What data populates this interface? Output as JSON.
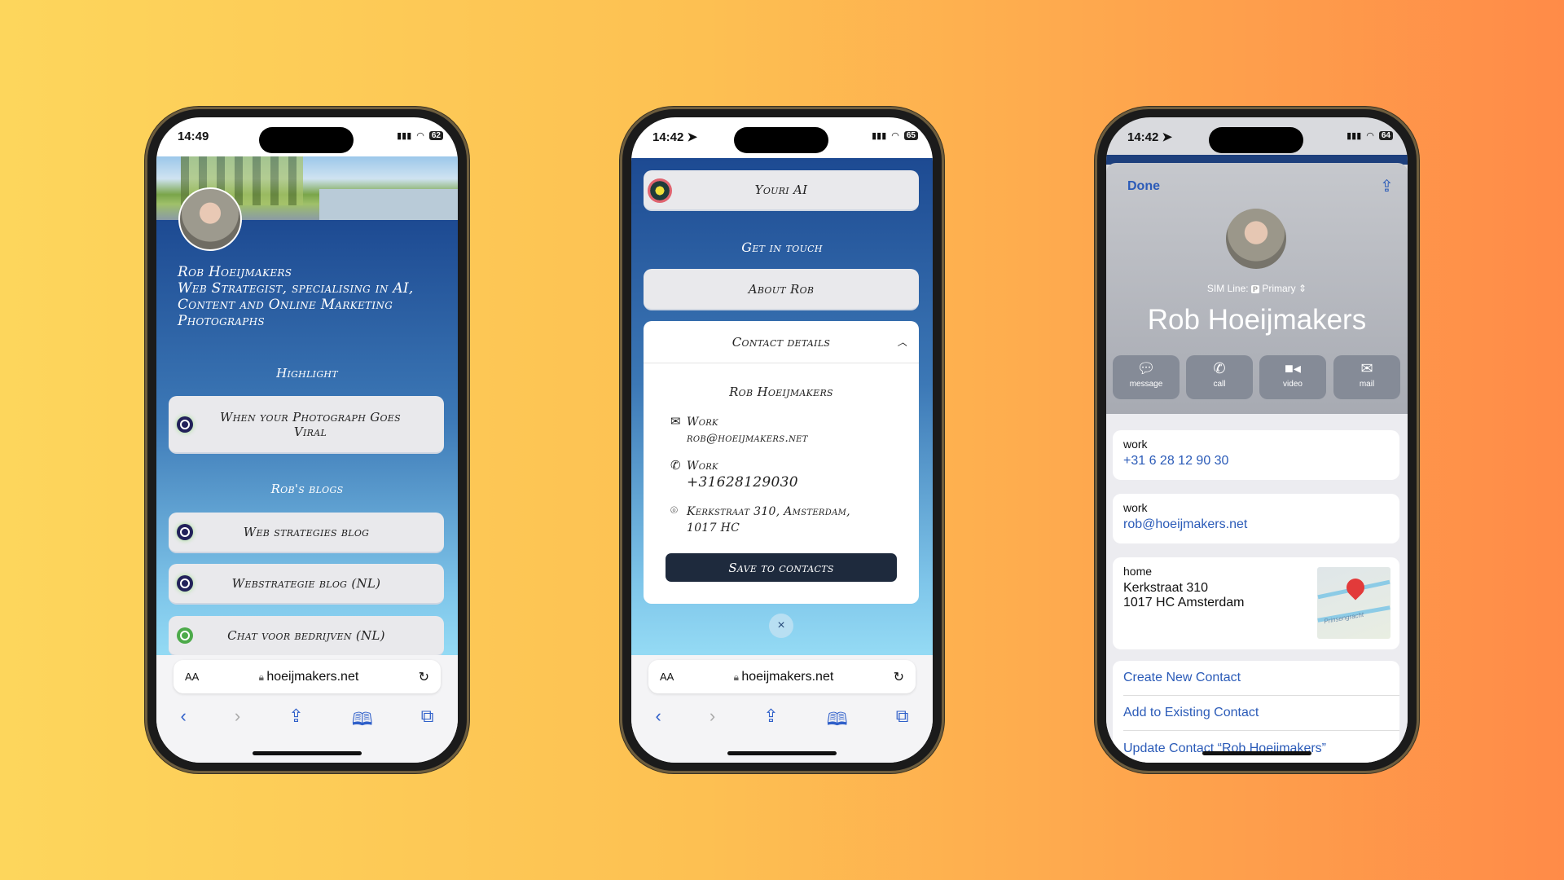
{
  "background": {
    "colors": [
      "#fdd65c",
      "#ff8b48"
    ]
  },
  "phone1": {
    "status": {
      "time": "14:49",
      "battery": "62"
    },
    "profile": {
      "name": "Rob Hoeijmakers",
      "tagline_lines": [
        "Web Strategist, specialising in AI,",
        "Content and Online Marketing",
        "Photographs"
      ]
    },
    "highlight": {
      "heading": "Highlight",
      "item": "When your Photograph Goes Viral"
    },
    "blogs": {
      "heading": "Rob's blogs",
      "items": [
        {
          "label": "Web strategies blog",
          "icon": "podcast-icon"
        },
        {
          "label": "Webstrategie blog (NL)",
          "icon": "podcast-icon"
        },
        {
          "label": "Chat voor bedrijven (NL)",
          "icon": "chat-icon"
        }
      ]
    },
    "safari": {
      "aa": "AA",
      "url": "hoeijmakers.net"
    }
  },
  "phone2": {
    "status": {
      "time": "14:42",
      "battery": "65"
    },
    "youri": "Youri AI",
    "get_in_touch": "Get in touch",
    "about": "About Rob",
    "contact": {
      "title": "Contact details",
      "name": "Rob Hoeijmakers",
      "email_label": "Work",
      "email": "rob@hoeijmakers.net",
      "phone_label": "Work",
      "phone": "+31628129030",
      "address_line1": "Kerkstraat 310, Amsterdam,",
      "address_line2": "1017 HC",
      "save": "Save to contacts",
      "close": "×"
    },
    "safari": {
      "aa": "AA",
      "url": "hoeijmakers.net"
    }
  },
  "phone3": {
    "status": {
      "time": "14:42",
      "battery": "64"
    },
    "done": "Done",
    "sim_label": "SIM Line:",
    "sim_badge": "P",
    "sim_value": "Primary",
    "name": "Rob Hoeijmakers",
    "actions": [
      "message",
      "call",
      "video",
      "mail"
    ],
    "phone": {
      "label": "work",
      "value": "+31 6 28 12 90 30"
    },
    "email": {
      "label": "work",
      "value": "rob@hoeijmakers.net"
    },
    "address": {
      "label": "home",
      "line1": "Kerkstraat 310",
      "line2": "1017 HC Amsterdam",
      "map_label": "Prinsengracht"
    },
    "rows": [
      "Create New Contact",
      "Add to Existing Contact",
      "Update Contact “Rob Hoeijmakers”"
    ],
    "accent": "#2b5bb8"
  }
}
